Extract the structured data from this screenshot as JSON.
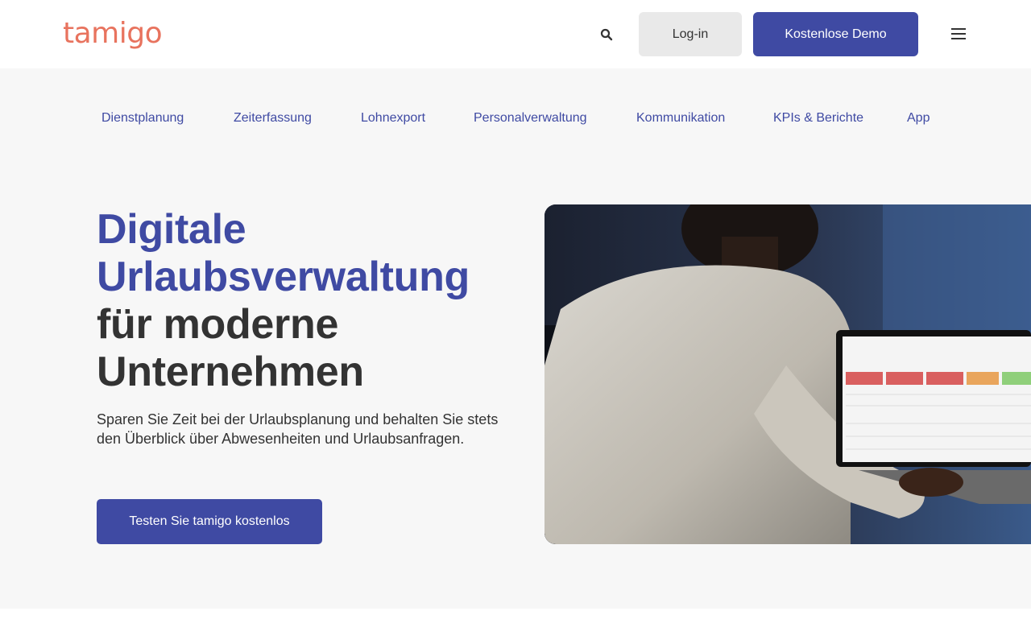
{
  "header": {
    "logo_text": "tamigo",
    "search_icon": "search-icon",
    "login_label": "Log-in",
    "demo_label": "Kostenlose Demo",
    "menu_icon": "hamburger-menu-icon"
  },
  "subnav": {
    "items": [
      {
        "label": "Dienstplanung"
      },
      {
        "label": "Zeiterfassung"
      },
      {
        "label": "Lohnexport"
      },
      {
        "label": "Personalverwaltung"
      },
      {
        "label": "Kommunikation"
      },
      {
        "label": "KPIs & Berichte"
      },
      {
        "label": "App"
      }
    ]
  },
  "hero": {
    "title_line1": "Digitale",
    "title_line2": "Urlaubsverwaltung",
    "title_line3": "für moderne",
    "title_line4": "Unternehmen",
    "lead": "Sparen Sie Zeit bei der Urlaubsplanung und behalten Sie stets den Überblick über Abwesenheiten und Urlaubsanfragen.",
    "cta_label": "Testen Sie tamigo kostenlos"
  },
  "colors": {
    "accent": "#3f4aa3",
    "logo": "#e8735e",
    "background": "#f7f7f7",
    "login_bg": "#e9e9e9"
  }
}
